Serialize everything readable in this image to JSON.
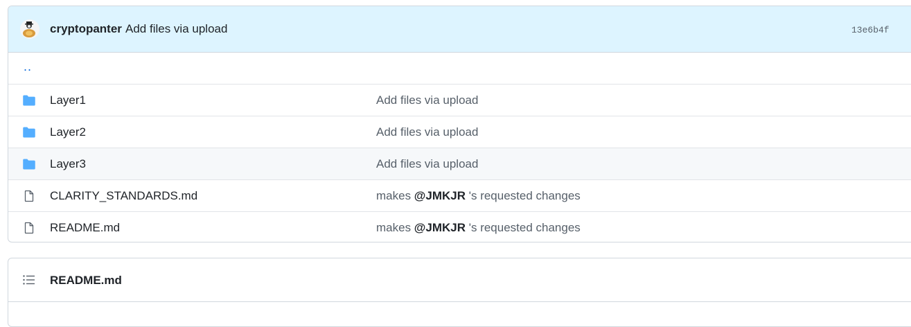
{
  "commit": {
    "author": "cryptopanter",
    "message": "Add files via upload",
    "sha": "13e6b4f"
  },
  "parent_link": "..",
  "files": [
    {
      "type": "folder",
      "name": "Layer1",
      "message": "Add files via upload"
    },
    {
      "type": "folder",
      "name": "Layer2",
      "message": "Add files via upload"
    },
    {
      "type": "folder",
      "name": "Layer3",
      "message": "Add files via upload"
    },
    {
      "type": "file",
      "name": "CLARITY_STANDARDS.md",
      "message_prefix": "makes ",
      "mention": "@JMKJR",
      "message_suffix": " 's requested changes"
    },
    {
      "type": "file",
      "name": "README.md",
      "message_prefix": "makes ",
      "mention": "@JMKJR",
      "message_suffix": " 's requested changes"
    }
  ],
  "readme": {
    "title": "README.md"
  },
  "colors": {
    "commit_bg": "#ddf4ff",
    "folder_icon": "#54aeff",
    "link": "#0969da"
  }
}
